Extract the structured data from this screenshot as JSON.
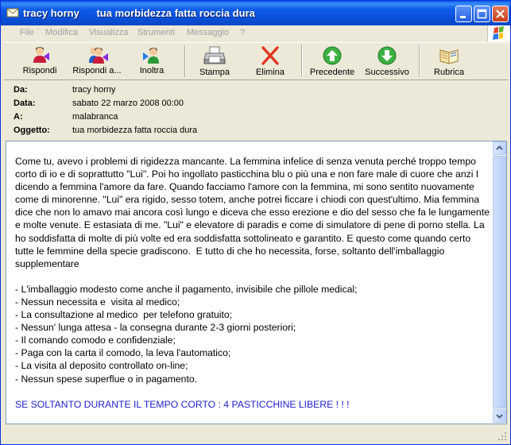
{
  "window": {
    "title": "tracy horny      tua morbidezza fatta roccia dura",
    "icons": [
      "envelope-icon",
      "minimize-icon",
      "maximize-icon",
      "close-icon"
    ]
  },
  "menu": {
    "items": [
      "File",
      "Modifica",
      "Visualizza",
      "Strumenti",
      "Messaggio",
      "?"
    ]
  },
  "toolbar": {
    "reply": "Rispondi",
    "reply_all": "Rispondi a...",
    "forward": "Inoltra",
    "print": "Stampa",
    "delete": "Elimina",
    "previous": "Precedente",
    "next": "Successivo",
    "addresses": "Rubrica"
  },
  "headers": {
    "from_label": "Da:",
    "from": "tracy horny",
    "date_label": "Data:",
    "date": "sabato 22 marzo 2008  00:00",
    "to_label": "A:",
    "to": "malabranca",
    "subject_label": "Oggetto:",
    "subject": "tua morbidezza fatta roccia dura"
  },
  "message": {
    "paragraph": "Come tu, avevo i problemi di rigidezza mancante. La femmina infelice di senza venuta perché troppo tempo corto di io e di soprattutto \"Lui\". Poi ho ingollato pasticchina blu o più una e non fare male di cuore che anzi I dicendo a femmina l'amore da fare. Quando facciamo l'amore con la femmina, mi sono sentito nuovamente come di minorenne. \"Lui\" era rigido, sesso totem, anche potrei ficcare i chiodi con quest'ultimo. Mia femmina dice che non lo amavo mai ancora così lungo e diceva che esso erezione e dio del sesso che fa le lungamente e molte venute. E estasiata di me. \"Lui\" e elevatore di paradis e come di simulatore di pene di porno stella. La ho soddisfatta di molte di più volte ed era soddisfatta sottolineato e garantito. E questo come quando certo tutte le femmine della specie gradiscono.  E tutto di che ho necessita, forse, soltanto dell'imballaggio supplementare",
    "list": [
      "- L'imballaggio modesto come anche il pagamento, invisibile che pillole medical;",
      "- Nessun necessita e  visita al medico;",
      "- La consultazione al medico  per telefono gratuito;",
      "- Nessun' lunga attesa - la consegna durante 2-3 giorni posteriori;",
      "- Il comando comodo e confidenziale;",
      "- Paga con la carta il comodo, la leva l'automatico;",
      "- La visita al deposito controllato on-line;",
      "- Nessun spese superflue o in pagamento."
    ],
    "offer": "SE SOLTANTO DURANTE IL TEMPO CORTO : 4 PASTICCHINE LIBERE ! ! !"
  },
  "colors": {
    "title_bar": "#0a50d8",
    "offer_text": "#1f1fd0",
    "disabled_menu": "#a0a0a0"
  }
}
